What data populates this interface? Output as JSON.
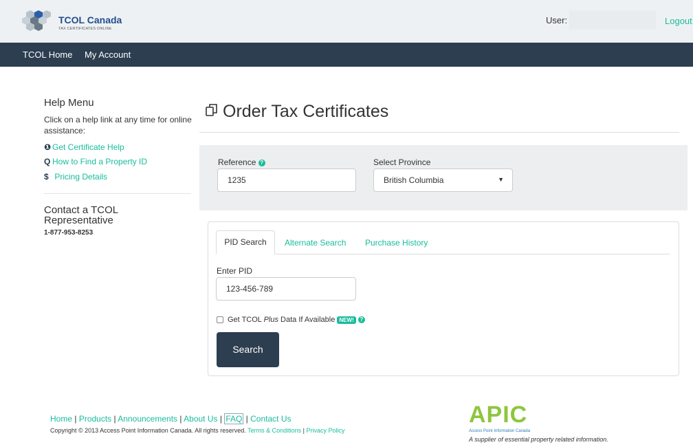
{
  "header": {
    "logo_title": "TCOL Canada",
    "logo_subtitle": "TAX CERTIFICATES ONLINE",
    "user_label": "User:",
    "logout_label": "Logout"
  },
  "nav": {
    "items": [
      {
        "label": "TCOL Home"
      },
      {
        "label": "My Account"
      }
    ]
  },
  "sidebar": {
    "help_title": "Help Menu",
    "help_desc": "Click on a help link at any time for online assistance:",
    "links": [
      {
        "icon": "info-icon",
        "glyph": "❶",
        "label": "Get Certificate Help"
      },
      {
        "icon": "search-icon",
        "glyph": "Q",
        "label": "How to Find a Property ID"
      },
      {
        "icon": "dollar-icon",
        "glyph": "$",
        "label": "Pricing Details"
      }
    ],
    "contact_title": "Contact a TCOL Representative",
    "contact_phone": "1-877-953-8253"
  },
  "main": {
    "title": "Order Tax Certificates",
    "reference_label": "Reference",
    "reference_value": "1235",
    "province_label": "Select Province",
    "province_value": "British Columbia",
    "tabs": [
      {
        "label": "PID Search",
        "active": true
      },
      {
        "label": "Alternate Search",
        "active": false
      },
      {
        "label": "Purchase History",
        "active": false
      }
    ],
    "pid_label": "Enter PID",
    "pid_value": "123-456-789",
    "plus_label_prefix": "Get TCOL ",
    "plus_label_italic": "Plus",
    "plus_label_suffix": " Data If Available",
    "new_badge": "NEW!",
    "search_button": "Search"
  },
  "footer": {
    "links": [
      "Home",
      "Products",
      "Announcements",
      "About Us",
      "FAQ",
      "Contact Us"
    ],
    "copyright": "Copyright © 2013 Access Point Information Canada. All rights reserved.",
    "terms_label": "Terms & Conditions",
    "privacy_label": "Privacy Policy",
    "apic_logo": "APIC",
    "apic_name": "Access Point Information Canada",
    "apic_tagline": "A supplier of essential property related information."
  },
  "colors": {
    "navbar": "#2c3e50",
    "accent": "#18bc9c",
    "panel": "#eceeef"
  }
}
